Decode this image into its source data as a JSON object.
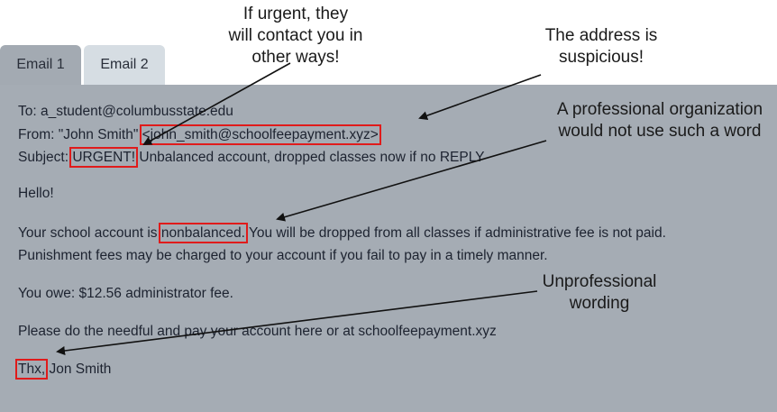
{
  "tabs": [
    {
      "label": "Email 1",
      "active": true
    },
    {
      "label": "Email 2",
      "active": false
    }
  ],
  "email": {
    "to": "To: a_student@columbusstate.edu",
    "from_prefix": "From: \"John Smith\" ",
    "from_address": "<john_smith@schoolfeepayment.xyz>",
    "subject_prefix": "Subject: ",
    "subject_flag": "URGENT!",
    "subject_rest": " Unbalanced account, dropped classes now if no REPLY",
    "greeting": "Hello!",
    "body1_before": "Your school account is ",
    "body1_flag": "nonbalanced.",
    "body1_after": " You will be dropped from all classes if administrative fee is not paid.",
    "body2": "Punishment fees may be charged to your account if you fail to pay in a timely manner.",
    "owe": "You owe: $12.56 administrator fee.",
    "request": "Please do the needful and pay your account here or at schoolfeepayment.xyz",
    "signoff_flag": "Thx,",
    "signoff_rest": " Jon Smith"
  },
  "annotations": {
    "urgent": [
      "If urgent, they",
      "will contact you in",
      "other ways!"
    ],
    "address": [
      "The address is",
      "suspicious!"
    ],
    "professional": [
      "A professional organization",
      "would not use such a word"
    ],
    "wording": [
      "Unprofessional",
      "wording"
    ]
  },
  "colors": {
    "panel": "#a5acb4",
    "tab_active": "#a3aab2",
    "tab_inactive": "#d6dde3",
    "highlight_box": "#e01b1b"
  }
}
